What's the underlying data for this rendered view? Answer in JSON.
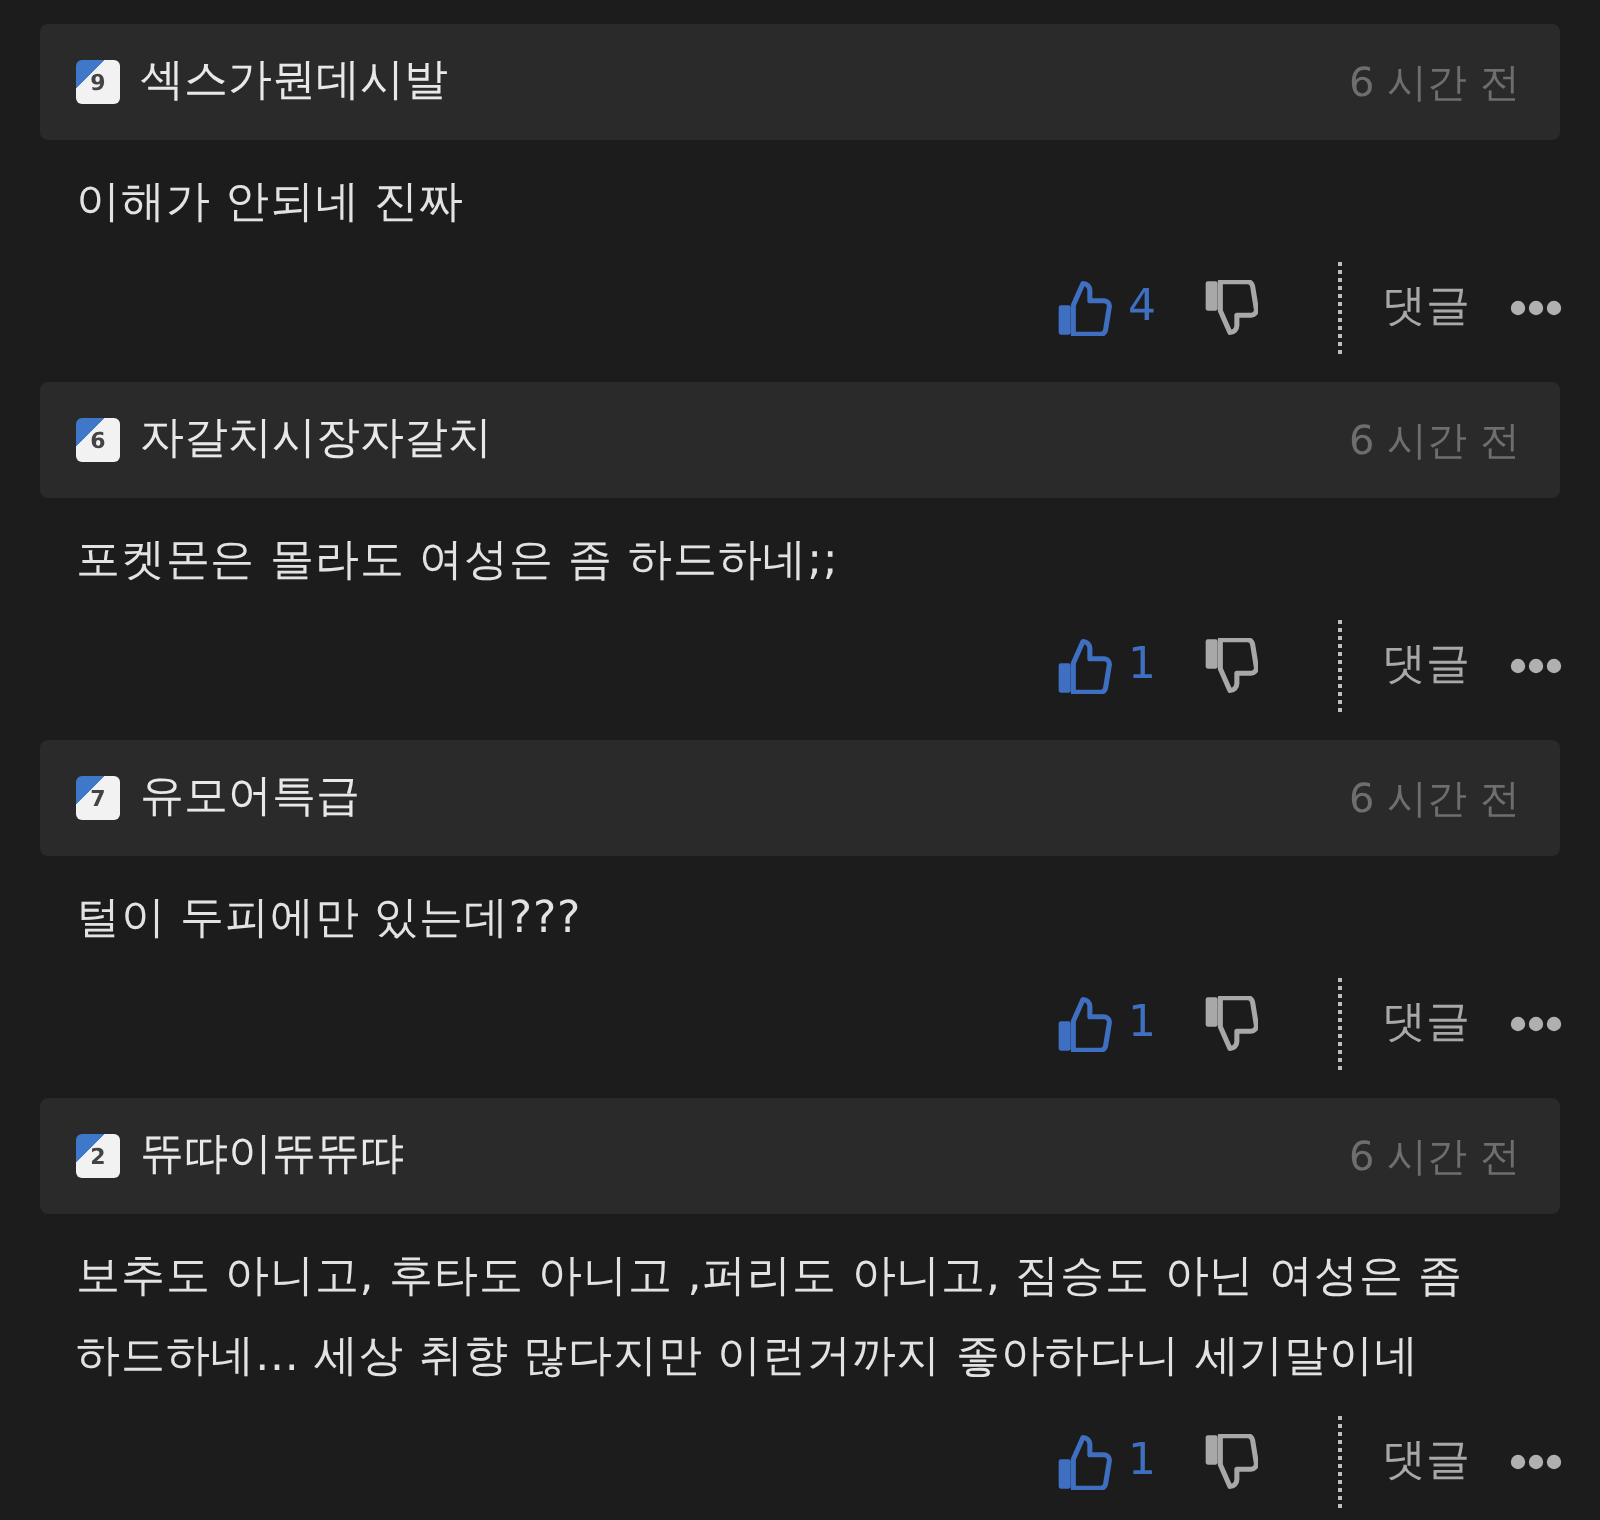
{
  "comments": [
    {
      "level_badge": "9",
      "username": "섹스가뭔데시발",
      "time": "6 시간 전",
      "text": "이해가 안되네 진짜",
      "likes": "4",
      "reply_label": "댓글"
    },
    {
      "level_badge": "6",
      "username": "자갈치시장자갈치",
      "time": "6 시간 전",
      "text": "포켓몬은 몰라도 여성은 좀 하드하네;;",
      "likes": "1",
      "reply_label": "댓글"
    },
    {
      "level_badge": "7",
      "username": "유모어특급",
      "time": "6 시간 전",
      "text": "털이 두피에만 있는데???",
      "likes": "1",
      "reply_label": "댓글"
    },
    {
      "level_badge": "2",
      "username": "뜌땨이뜌뜌땨",
      "time": "6 시간 전",
      "text": "보추도 아니고, 후타도 아니고 ,퍼리도 아니고, 짐승도 아닌 여성은 좀 하드하네... 세상 취향 많다지만 이런거까지 좋아하다니 세기말이네",
      "likes": "1",
      "reply_label": "댓글"
    }
  ]
}
